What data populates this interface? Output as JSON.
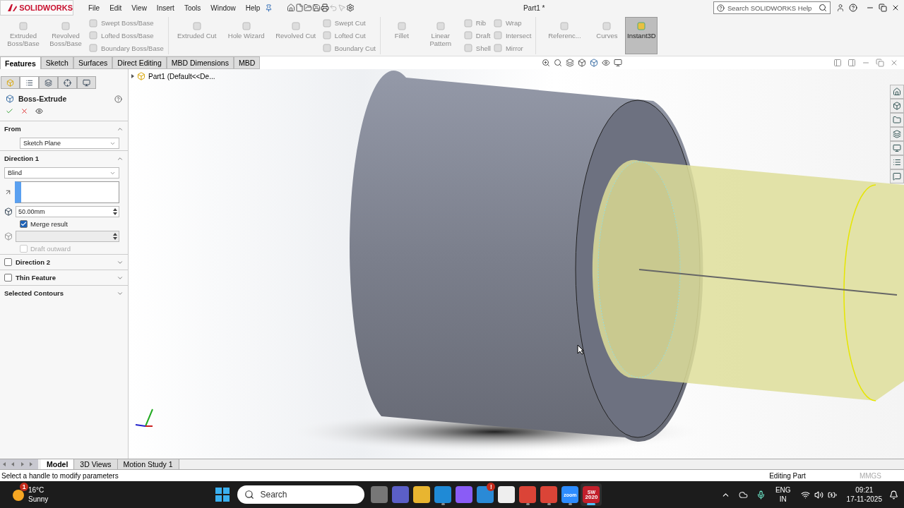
{
  "app": {
    "logo_text": "SOLIDWORKS",
    "menu": [
      "File",
      "Edit",
      "View",
      "Insert",
      "Tools",
      "Window",
      "Help"
    ],
    "document_title": "Part1 *",
    "help_search": {
      "placeholder": "Search SOLIDWORKS Help"
    }
  },
  "ribbon": [
    {
      "items": [
        {
          "kind": "large",
          "label": "Extruded Boss/Base",
          "disabled": true,
          "selected": false
        },
        {
          "kind": "large",
          "label": "Revolved Boss/Base",
          "disabled": true,
          "selected": false
        },
        {
          "kind": "stack",
          "items": [
            {
              "label": "Swept Boss/Base",
              "disabled": true
            },
            {
              "label": "Lofted Boss/Base",
              "disabled": true
            },
            {
              "label": "Boundary Boss/Base",
              "disabled": true
            }
          ]
        }
      ]
    },
    {
      "items": [
        {
          "kind": "large",
          "label": "Extruded Cut",
          "disabled": true,
          "selected": false
        },
        {
          "kind": "large",
          "label": "Hole Wizard",
          "disabled": true,
          "selected": false
        },
        {
          "kind": "large",
          "label": "Revolved Cut",
          "disabled": true,
          "selected": false
        },
        {
          "kind": "stack",
          "items": [
            {
              "label": "Swept Cut",
              "disabled": true
            },
            {
              "label": "Lofted Cut",
              "disabled": true
            },
            {
              "label": "Boundary Cut",
              "disabled": true
            }
          ]
        }
      ]
    },
    {
      "items": [
        {
          "kind": "large",
          "label": "Fillet",
          "disabled": true,
          "selected": false
        },
        {
          "kind": "large",
          "label": "Linear Pattern",
          "disabled": true,
          "selected": false
        },
        {
          "kind": "stack",
          "items": [
            {
              "label": "Rib",
              "disabled": true
            },
            {
              "label": "Draft",
              "disabled": true
            },
            {
              "label": "Shell",
              "disabled": true
            }
          ]
        },
        {
          "kind": "stack",
          "items": [
            {
              "label": "Wrap",
              "disabled": true
            },
            {
              "label": "Intersect",
              "disabled": true
            },
            {
              "label": "Mirror",
              "disabled": true
            }
          ]
        }
      ]
    },
    {
      "items": [
        {
          "kind": "large",
          "label": "Referenc...",
          "disabled": true,
          "selected": false
        },
        {
          "kind": "large",
          "label": "Curves",
          "disabled": true,
          "selected": false
        },
        {
          "kind": "large",
          "label": "Instant3D",
          "disabled": false,
          "selected": true
        }
      ]
    }
  ],
  "command_tabs": [
    {
      "label": "Features",
      "selected": true
    },
    {
      "label": "Sketch",
      "selected": false
    },
    {
      "label": "Surfaces",
      "selected": false
    },
    {
      "label": "Direct Editing",
      "selected": false
    },
    {
      "label": "MBD Dimensions",
      "selected": false
    },
    {
      "label": "MBD",
      "selected": false
    }
  ],
  "manager_tabs": [
    {
      "kind": "features",
      "selected": false
    },
    {
      "kind": "tree",
      "selected": true
    },
    {
      "kind": "config",
      "selected": false
    },
    {
      "kind": "dimxpert",
      "selected": false
    },
    {
      "kind": "display",
      "selected": false
    }
  ],
  "property_manager": {
    "title": "Boss-Extrude",
    "sections": [
      {
        "title": "From",
        "kind": "plain",
        "expanded": true,
        "controls": [
          {
            "kind": "select",
            "value": "Sketch Plane"
          }
        ]
      },
      {
        "title": "Direction 1",
        "kind": "plain",
        "expanded": true,
        "controls": [
          {
            "kind": "select",
            "value": "Blind"
          },
          {
            "kind": "selection_box"
          },
          {
            "kind": "spin",
            "value": "50.00mm",
            "disabled": false
          },
          {
            "kind": "checkbox",
            "label": "Merge result",
            "checked": true,
            "disabled": false
          },
          {
            "kind": "spin",
            "disabled": true
          },
          {
            "kind": "checkbox",
            "label": "Draft outward",
            "checked": false,
            "disabled": true
          }
        ]
      },
      {
        "title": "Direction 2",
        "kind": "checkbox",
        "checked": false,
        "expanded": false
      },
      {
        "title": "Thin Feature",
        "kind": "checkbox",
        "checked": false,
        "expanded": false
      },
      {
        "title": "Selected Contours",
        "kind": "plain",
        "expanded": false
      }
    ]
  },
  "feature_tree": {
    "label": "Part1 (Default<<De..."
  },
  "bottom_tabs": [
    {
      "label": "Model",
      "selected": true
    },
    {
      "label": "3D Views",
      "selected": false
    },
    {
      "label": "Motion Study 1",
      "selected": false
    }
  ],
  "status_bar": {
    "message": "Select a handle to modify parameters",
    "mode": "Editing Part",
    "units": "MMGS"
  },
  "taskbar": {
    "weather": {
      "temperature": "16°C",
      "condition": "Sunny",
      "badge": "1"
    },
    "search": {
      "placeholder": "Search"
    },
    "apps": [
      {
        "kind": "taskview",
        "active": false,
        "running": false
      },
      {
        "kind": "chat",
        "active": false,
        "running": false
      },
      {
        "kind": "explorer",
        "active": false,
        "running": false
      },
      {
        "kind": "edge",
        "active": false,
        "running": true
      },
      {
        "kind": "copilot",
        "active": false,
        "running": false
      },
      {
        "kind": "help",
        "badge": "!",
        "active": false,
        "running": false
      },
      {
        "kind": "store",
        "active": false,
        "running": false
      },
      {
        "kind": "chrome",
        "active": false,
        "running": true
      },
      {
        "kind": "chrome",
        "active": false,
        "running": true
      },
      {
        "kind": "zoom",
        "label": "zoom",
        "active": false,
        "running": true
      },
      {
        "kind": "solidworks",
        "label": "SW",
        "sublabel": "2020",
        "active": true,
        "running": true
      }
    ],
    "language": "ENG",
    "region": "IN",
    "time": "09:21",
    "date": "17-11-2025"
  }
}
